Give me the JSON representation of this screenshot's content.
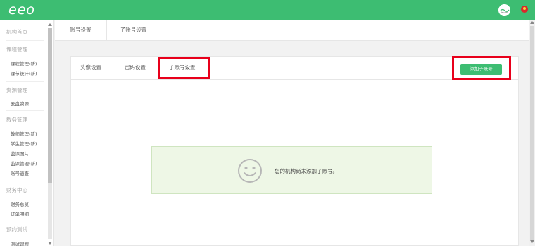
{
  "header": {
    "logo_text": "eeo",
    "brand_color": "#3dbd72"
  },
  "sidebar": {
    "items": [
      {
        "label": "机构首页",
        "type": "head"
      },
      {
        "label": "课程管理",
        "type": "head"
      },
      {
        "label": "课程管理(新)",
        "type": "sub"
      },
      {
        "label": "课节统计(新)",
        "type": "sub"
      },
      {
        "label": "资源管理",
        "type": "head"
      },
      {
        "label": "云盘资源",
        "type": "sub"
      },
      {
        "label": "教务管理",
        "type": "head"
      },
      {
        "label": "教师管理(新)",
        "type": "sub"
      },
      {
        "label": "学生管理(新)",
        "type": "sub"
      },
      {
        "label": "监课图片",
        "type": "sub"
      },
      {
        "label": "监课管理(新)",
        "type": "sub"
      },
      {
        "label": "账号速查",
        "type": "sub"
      },
      {
        "label": "财务中心",
        "type": "head"
      },
      {
        "label": "财务总览",
        "type": "sub"
      },
      {
        "label": "订单明细",
        "type": "sub"
      },
      {
        "label": "预约测试",
        "type": "head"
      },
      {
        "label": "测试课程",
        "type": "sub"
      }
    ]
  },
  "top_tabs": [
    "账号设置",
    "子账号设置"
  ],
  "panel": {
    "tabs": [
      "头像设置",
      "密码设置",
      "子账号设置"
    ],
    "active_tab": "子账号设置",
    "add_button_label": "添加子账号",
    "highlight_color": "#e8001b"
  },
  "empty_state": {
    "icon": "smile-icon",
    "message": "您的机构尚未添加子账号。"
  }
}
